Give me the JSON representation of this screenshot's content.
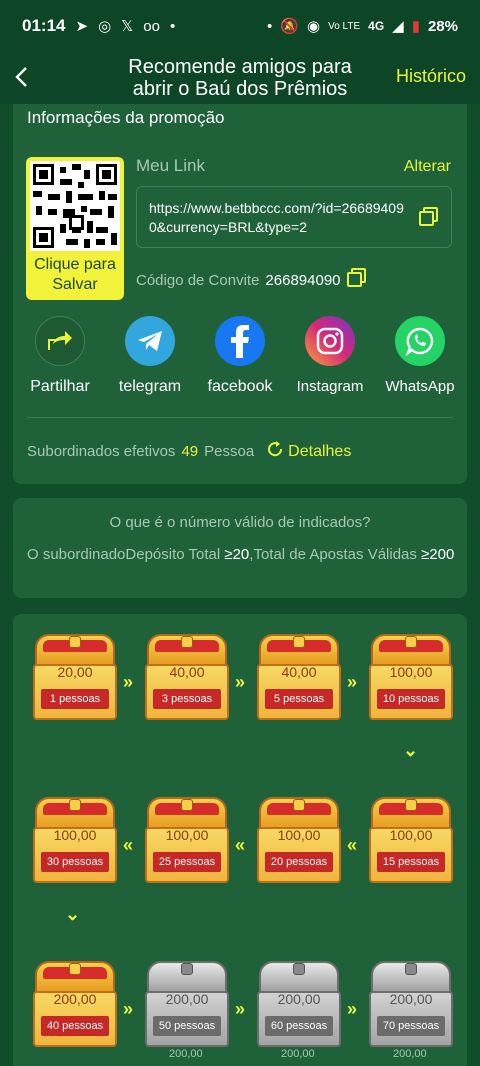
{
  "status_bar": {
    "time": "01:14",
    "battery": "28%",
    "network": "4G"
  },
  "header": {
    "title": "Recomende amigos para abrir o Baú dos Prêmios",
    "history": "Histórico"
  },
  "promo": {
    "section_title": "Informações da promoção",
    "qr_save": "Clique para Salvar",
    "my_link_label": "Meu Link",
    "change": "Alterar",
    "link": "https://www.betbbccc.com/?id=266894090&currency=BRL&type=2",
    "invite_label": "Código de Convite",
    "invite_code": "266894090",
    "share": [
      {
        "label": "Partilhar",
        "icon": "share-icon",
        "color": "#1d5a33"
      },
      {
        "label": "telegram",
        "icon": "telegram-icon",
        "color": "#33a6de"
      },
      {
        "label": "facebook",
        "icon": "facebook-icon",
        "color": "#1877f2"
      },
      {
        "label": "Instagram",
        "icon": "instagram-icon",
        "color": "#d62976"
      },
      {
        "label": "WhatsApp",
        "icon": "whatsapp-icon",
        "color": "#25d366"
      }
    ],
    "subordinates_label": "Subordinados efetivos",
    "subordinates_count": "49",
    "subordinates_unit": "Pessoa",
    "details": "Detalhes"
  },
  "valid": {
    "question": "O que é o número válido de indicados?",
    "text_prefix": "O subordinadoDepósito Total",
    "deposit_req": "≥20",
    "text_mid": ",Total de Apostas Válidas",
    "bets_req": "≥200"
  },
  "chests": [
    {
      "amount": "20,00",
      "people": "1 pessoas",
      "type": "gold"
    },
    {
      "amount": "40,00",
      "people": "3 pessoas",
      "type": "gold"
    },
    {
      "amount": "40,00",
      "people": "5 pessoas",
      "type": "gold"
    },
    {
      "amount": "100,00",
      "people": "10 pessoas",
      "type": "gold"
    },
    {
      "amount": "100,00",
      "people": "15 pessoas",
      "type": "gold"
    },
    {
      "amount": "100,00",
      "people": "20 pessoas",
      "type": "gold"
    },
    {
      "amount": "100,00",
      "people": "25 pessoas",
      "type": "gold"
    },
    {
      "amount": "100,00",
      "people": "30 pessoas",
      "type": "gold"
    },
    {
      "amount": "200,00",
      "people": "40 pessoas",
      "type": "gold"
    },
    {
      "amount": "200,00",
      "people": "50 pessoas",
      "type": "silver"
    },
    {
      "amount": "200,00",
      "people": "60 pessoas",
      "type": "silver"
    },
    {
      "amount": "200,00",
      "people": "70 pessoas",
      "type": "silver"
    }
  ],
  "arrows": {
    "right": "»",
    "left": "«",
    "down": "⌄"
  }
}
